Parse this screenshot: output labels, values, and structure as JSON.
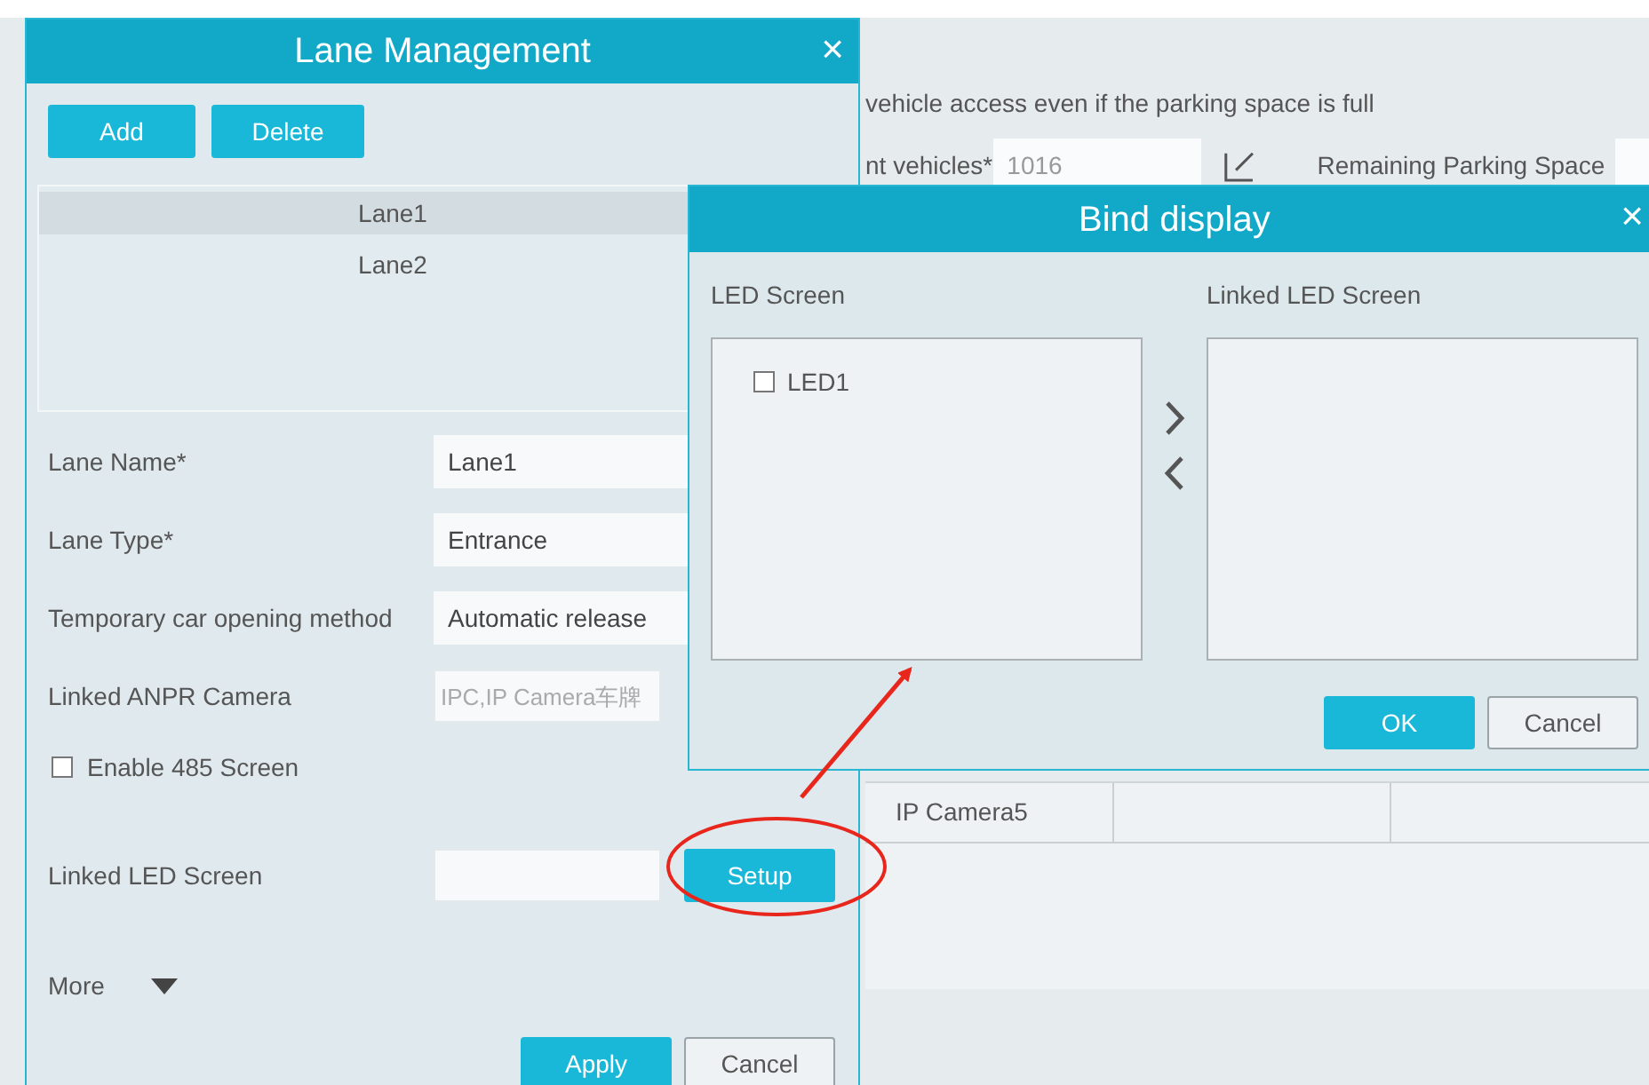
{
  "background": {
    "notice": "vehicle access even if the parking space is full",
    "count_label": "nt vehicles*",
    "count_value": "1016",
    "remaining_label": "Remaining Parking Space",
    "table_rows": [
      {
        "cells": [
          "IP Camera5"
        ]
      }
    ]
  },
  "lane_dialog": {
    "title": "Lane Management",
    "close": "×",
    "buttons": [
      "Add",
      "Delete"
    ],
    "lanes": [
      {
        "name": "Lane1",
        "selected": true
      },
      {
        "name": "Lane2",
        "selected": false
      }
    ],
    "fields": [
      {
        "label": "Lane Name*",
        "value": "Lane1"
      },
      {
        "label": "Lane Type*",
        "value": "Entrance"
      },
      {
        "label": "Temporary car opening method",
        "value": "Automatic release"
      },
      {
        "label": "Linked ANPR Camera",
        "placeholder": "IPC,IP Camera车牌"
      }
    ],
    "enable_485": {
      "label": "Enable 485 Screen",
      "checked": false
    },
    "linked_led": {
      "label": "Linked LED Screen",
      "button": "Setup"
    },
    "more": "More",
    "footer_buttons": [
      "Apply",
      "Cancel"
    ]
  },
  "bind_dialog": {
    "title": "Bind display",
    "close": "×",
    "left_title": "LED Screen",
    "right_title": "Linked LED Screen",
    "left_items": [
      {
        "label": "LED1",
        "checked": false
      }
    ],
    "ok": "OK",
    "cancel": "Cancel"
  }
}
